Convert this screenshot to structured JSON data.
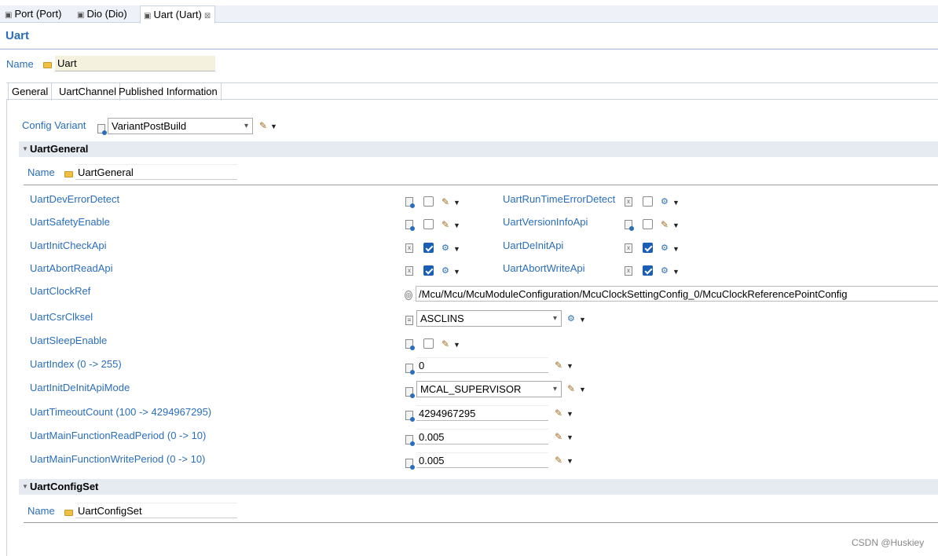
{
  "editor_tabs": [
    {
      "label": "Port (Port)",
      "active": false
    },
    {
      "label": "Dio (Dio)",
      "active": false
    },
    {
      "label": "Uart (Uart)",
      "active": true,
      "close": "⊠"
    }
  ],
  "form": {
    "title": "Uart",
    "name_label": "Name",
    "name_value": "Uart"
  },
  "page_tabs": [
    {
      "label": "General",
      "active": true
    },
    {
      "label": "UartChannel",
      "active": false
    },
    {
      "label": "Published Information",
      "active": false
    }
  ],
  "config_variant": {
    "label": "Config Variant",
    "value": "VariantPostBuild"
  },
  "uart_general": {
    "title": "UartGeneral",
    "name_label": "Name",
    "name_value": "UartGeneral",
    "left_params": [
      {
        "label": "UartDevErrorDetect",
        "checked": false,
        "icon": "pencil-icon"
      },
      {
        "label": "UartSafetyEnable",
        "checked": false,
        "icon": "pencil-icon"
      },
      {
        "label": "UartInitCheckApi",
        "checked": true,
        "icon": "gear-icon"
      },
      {
        "label": "UartAbortReadApi",
        "checked": true,
        "icon": "gear-icon"
      }
    ],
    "right_params": [
      {
        "label": "UartRunTimeErrorDetect",
        "checked": false,
        "icon": "gear-icon"
      },
      {
        "label": "UartVersionInfoApi",
        "checked": false,
        "icon": "pencil-icon"
      },
      {
        "label": "UartDeInitApi",
        "checked": true,
        "icon": "gear-icon"
      },
      {
        "label": "UartAbortWriteApi",
        "checked": true,
        "icon": "gear-icon"
      }
    ],
    "clock_ref": {
      "label": "UartClockRef",
      "value": "/Mcu/Mcu/McuModuleConfiguration/McuClockSettingConfig_0/McuClockReferencePointConfig"
    },
    "csr_clksel": {
      "label": "UartCsrClksel",
      "value": "ASCLINS"
    },
    "sleep_enable": {
      "label": "UartSleepEnable",
      "checked": false
    },
    "index": {
      "label": "UartIndex (0 -> 255)",
      "value": "0"
    },
    "init_deinit_mode": {
      "label": "UartInitDeInitApiMode",
      "value": "MCAL_SUPERVISOR"
    },
    "timeout_count": {
      "label": "UartTimeoutCount (100 -> 4294967295)",
      "value": "4294967295"
    },
    "main_read_period": {
      "label": "UartMainFunctionReadPeriod (0 -> 10)",
      "value": "0.005"
    },
    "main_write_period": {
      "label": "UartMainFunctionWritePeriod (0 -> 10)",
      "value": "0.005"
    }
  },
  "uart_config_set": {
    "title": "UartConfigSet",
    "name_label": "Name",
    "name_value": "UartConfigSet"
  },
  "watermark": "CSDN @Huskiey"
}
